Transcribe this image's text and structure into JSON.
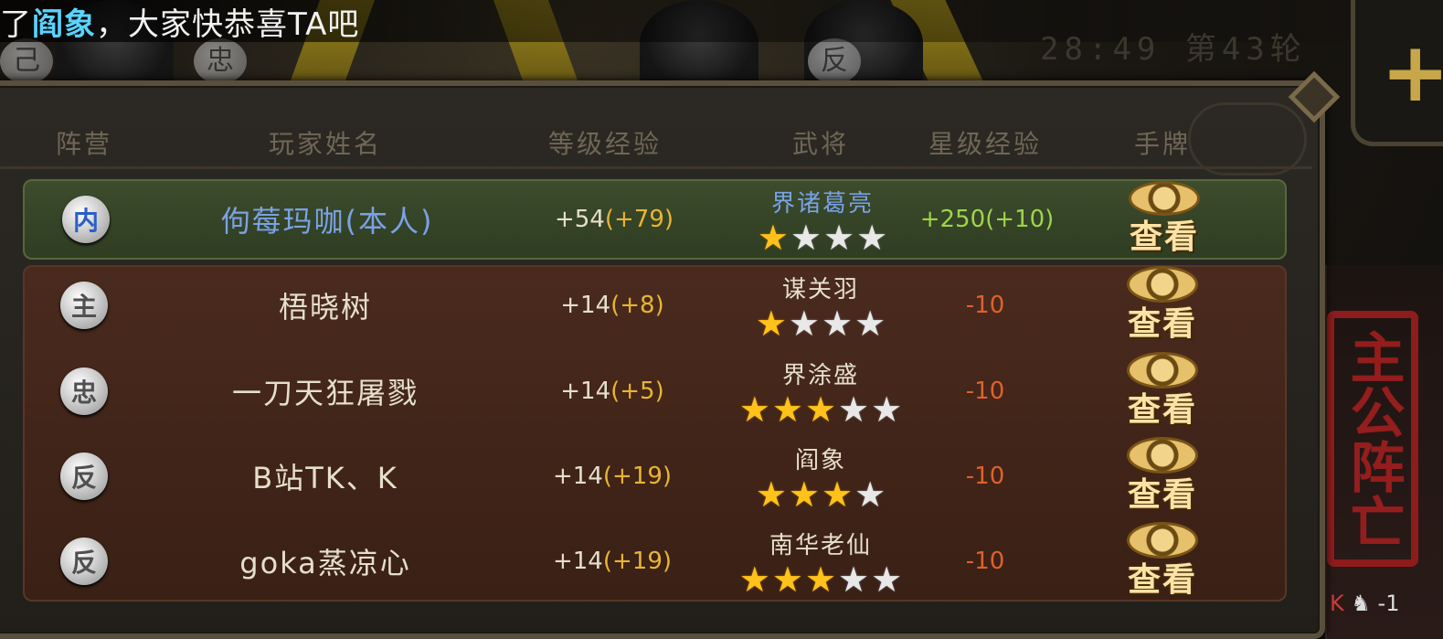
{
  "announcement": {
    "prefix": "了",
    "highlight": "阎象",
    "suffix": "，大家快恭喜TA吧"
  },
  "round_info": "28:49 第43轮",
  "background_tokens": [
    "己",
    "忠",
    "反"
  ],
  "headers": {
    "faction": "阵营",
    "player_name": "玩家姓名",
    "level_exp": "等级经验",
    "general": "武将",
    "star_exp": "星级经验",
    "hand": "手牌"
  },
  "players": [
    {
      "faction": "内",
      "name": "佝莓玛咖",
      "self_tag": "(本人)",
      "level_exp": "+54",
      "level_bonus": "(+79)",
      "general": "界诸葛亮",
      "stars_on": 1,
      "stars_total": 4,
      "star_exp": "+250(+10)",
      "star_exp_sign": "pos",
      "view_label": "查看"
    },
    {
      "faction": "主",
      "name": "梧晓树",
      "self_tag": "",
      "level_exp": "+14",
      "level_bonus": "(+8)",
      "general": "谋关羽",
      "stars_on": 1,
      "stars_total": 4,
      "star_exp": "-10",
      "star_exp_sign": "neg",
      "view_label": "查看"
    },
    {
      "faction": "忠",
      "name": "一刀天狂屠戮",
      "self_tag": "",
      "level_exp": "+14",
      "level_bonus": "(+5)",
      "general": "界涂盛",
      "stars_on": 3,
      "stars_total": 5,
      "star_exp": "-10",
      "star_exp_sign": "neg",
      "view_label": "查看"
    },
    {
      "faction": "反",
      "name": "B站TK、K",
      "self_tag": "",
      "level_exp": "+14",
      "level_bonus": "(+19)",
      "general": "阎象",
      "stars_on": 3,
      "stars_total": 4,
      "star_exp": "-10",
      "star_exp_sign": "neg",
      "view_label": "查看"
    },
    {
      "faction": "反",
      "name": "goka蒸凉心",
      "self_tag": "",
      "level_exp": "+14",
      "level_bonus": "(+19)",
      "general": "南华老仙",
      "stars_on": 3,
      "stars_total": 5,
      "star_exp": "-10",
      "star_exp_sign": "neg",
      "view_label": "查看"
    }
  ],
  "side": {
    "plus_label": "+",
    "seal_text": "主公阵亡",
    "bottom_k": "K",
    "bottom_count": "-1"
  },
  "colors": {
    "self_row": "#34442a",
    "other_rows": "#42261a",
    "bonus": "#e8b532",
    "star_on": "#ffc21a",
    "star_exp_pos": "#9ed44a",
    "star_exp_neg": "#e0612a"
  }
}
